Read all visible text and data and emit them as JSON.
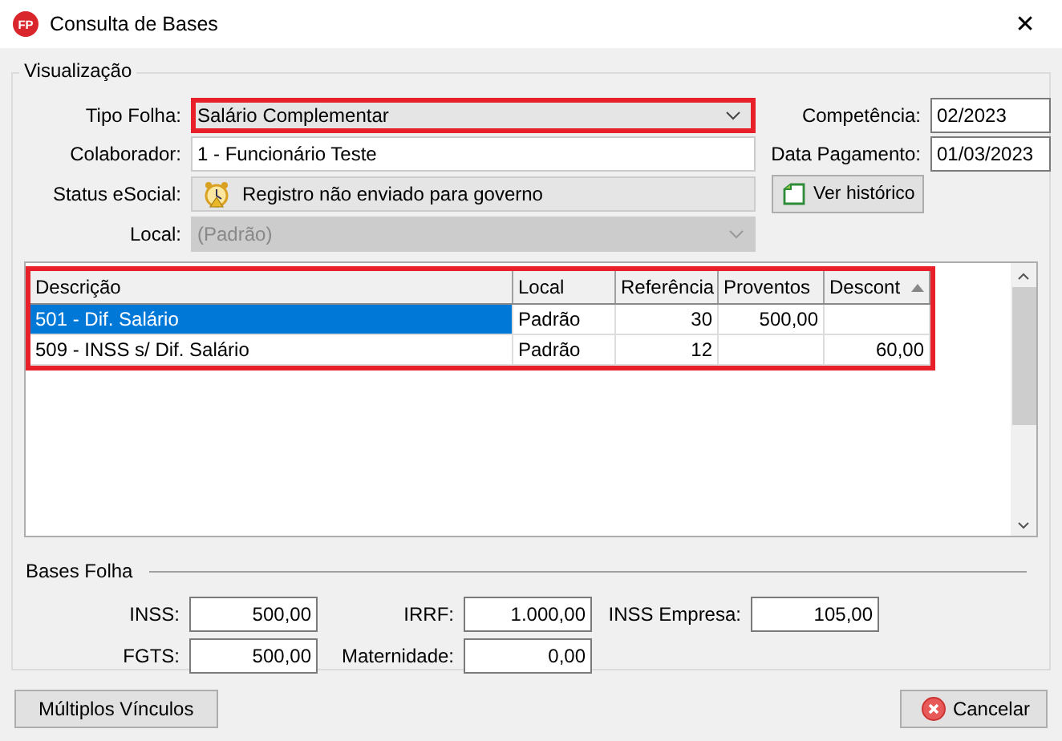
{
  "window": {
    "logo": "FP",
    "title": "Consulta de Bases",
    "close": "✕"
  },
  "visualizacao": {
    "title": "Visualização",
    "tipo_folha": {
      "label": "Tipo Folha:",
      "value": "Salário Complementar",
      "highlighted": true
    },
    "colaborador": {
      "label": "Colaborador:",
      "value": "1 - Funcionário Teste"
    },
    "status_esocial": {
      "label": "Status eSocial:",
      "value": "Registro não enviado para governo"
    },
    "local": {
      "label": "Local:",
      "value": "(Padrão)",
      "disabled": true
    },
    "competencia": {
      "label": "Competência:",
      "value": "02/2023"
    },
    "data_pagamento": {
      "label": "Data Pagamento:",
      "value": "01/03/2023"
    },
    "ver_historico": "Ver histórico"
  },
  "table": {
    "highlighted": true,
    "columns": [
      {
        "label": "Descrição",
        "sorted": false
      },
      {
        "label": "Local",
        "sorted": false
      },
      {
        "label": "Referência",
        "sorted": false
      },
      {
        "label": "Proventos",
        "sorted": false
      },
      {
        "label": "Descont",
        "sorted": true
      }
    ],
    "rows": [
      {
        "selected": true,
        "cells": [
          "501 - Dif. Salário",
          "Padrão",
          "30",
          "500,00",
          ""
        ]
      },
      {
        "selected": false,
        "cells": [
          "509 - INSS s/ Dif. Salário",
          "Padrão",
          "12",
          "",
          "60,00"
        ]
      }
    ]
  },
  "bases_folha": {
    "title": "Bases Folha",
    "fields": [
      {
        "label": "INSS:",
        "value": "500,00"
      },
      {
        "label": "IRRF:",
        "value": "1.000,00"
      },
      {
        "label": "INSS Empresa:",
        "value": "105,00"
      },
      {
        "label": "FGTS:",
        "value": "500,00"
      },
      {
        "label": "Maternidade:",
        "value": "0,00"
      }
    ]
  },
  "buttons": {
    "multiplos": "Múltiplos Vínculos",
    "cancelar": "Cancelar"
  }
}
